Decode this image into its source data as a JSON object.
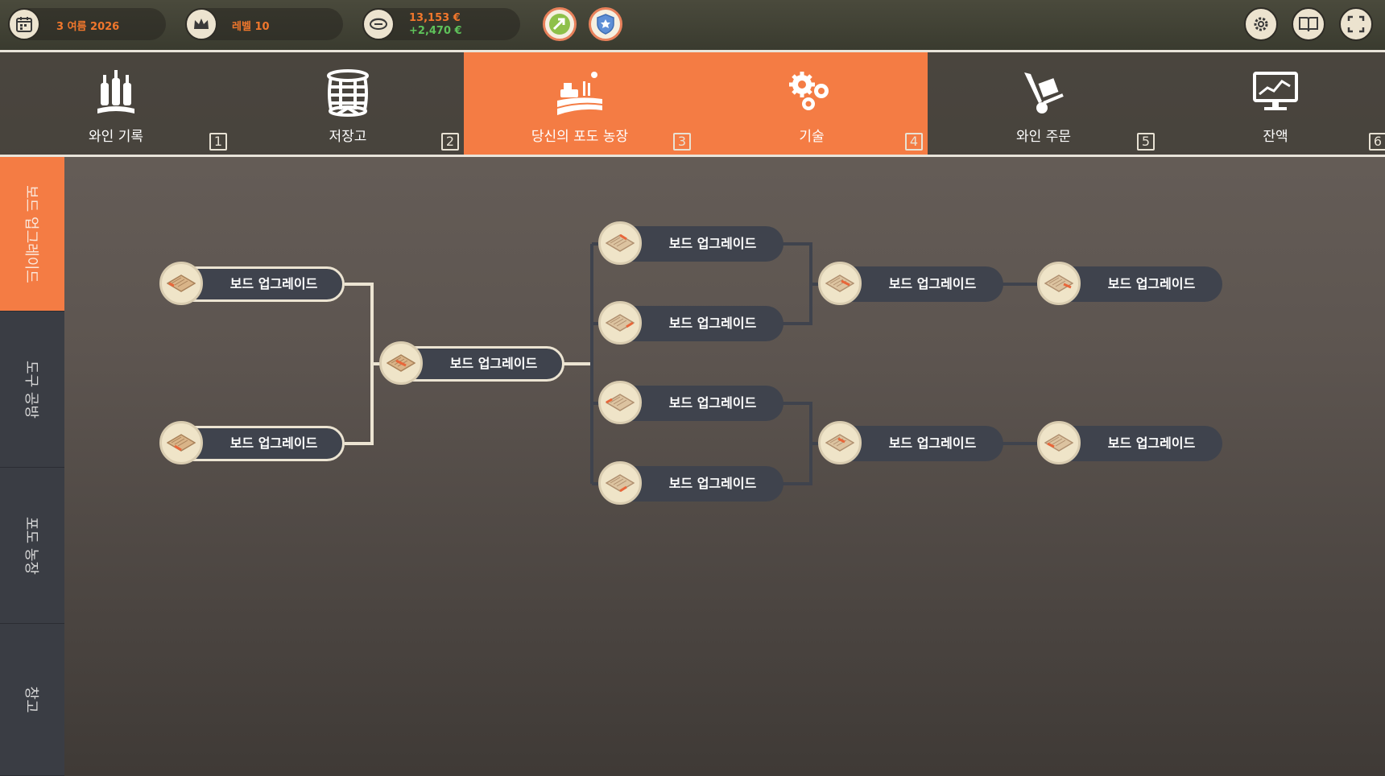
{
  "status": {
    "date": "3 여름 2026",
    "level": "레벨 10",
    "money": "13,153 €",
    "income": "+2,470 €"
  },
  "colors": {
    "accent": "#f47c44",
    "money": "#f0772c",
    "income": "#5ec25a",
    "node_pill": "#3f434d",
    "line": "#ece4d2"
  },
  "top_icons": [
    "calendar-icon",
    "crown-icon",
    "coins-icon",
    "trend-up-icon",
    "shield-icon",
    "gear-icon",
    "book-icon",
    "fullscreen-icon"
  ],
  "tabs": [
    {
      "label": "와인 기록",
      "key": "1",
      "icon": "wine-bottles-icon"
    },
    {
      "label": "저장고",
      "key": "2",
      "icon": "barrel-icon"
    },
    {
      "label": "당신의 포도 농장",
      "key": "3",
      "icon": "vineyard-icon"
    },
    {
      "label": "기술",
      "key": "4",
      "icon": "gears-icon"
    },
    {
      "label": "와인 주문",
      "key": "5",
      "icon": "hand-truck-icon"
    },
    {
      "label": "잔액",
      "key": "6",
      "icon": "monitor-chart-icon"
    }
  ],
  "side_tabs": [
    {
      "label": "보드 업그레이드"
    },
    {
      "label": "도구 공방"
    },
    {
      "label": "포도 농장"
    },
    {
      "label": "창고"
    }
  ],
  "tree": {
    "nodes": [
      {
        "label": "보드 업그레이드",
        "state": "unlocked"
      },
      {
        "label": "보드 업그레이드",
        "state": "unlocked"
      },
      {
        "label": "보드 업그레이드",
        "state": "unlocked"
      },
      {
        "label": "보드 업그레이드",
        "state": "locked"
      },
      {
        "label": "보드 업그레이드",
        "state": "locked"
      },
      {
        "label": "보드 업그레이드",
        "state": "locked"
      },
      {
        "label": "보드 업그레이드",
        "state": "locked"
      },
      {
        "label": "보드 업그레이드",
        "state": "locked"
      },
      {
        "label": "보드 업그레이드",
        "state": "locked"
      },
      {
        "label": "보드 업그레이드",
        "state": "locked"
      },
      {
        "label": "보드 업그레이드",
        "state": "locked"
      }
    ]
  }
}
